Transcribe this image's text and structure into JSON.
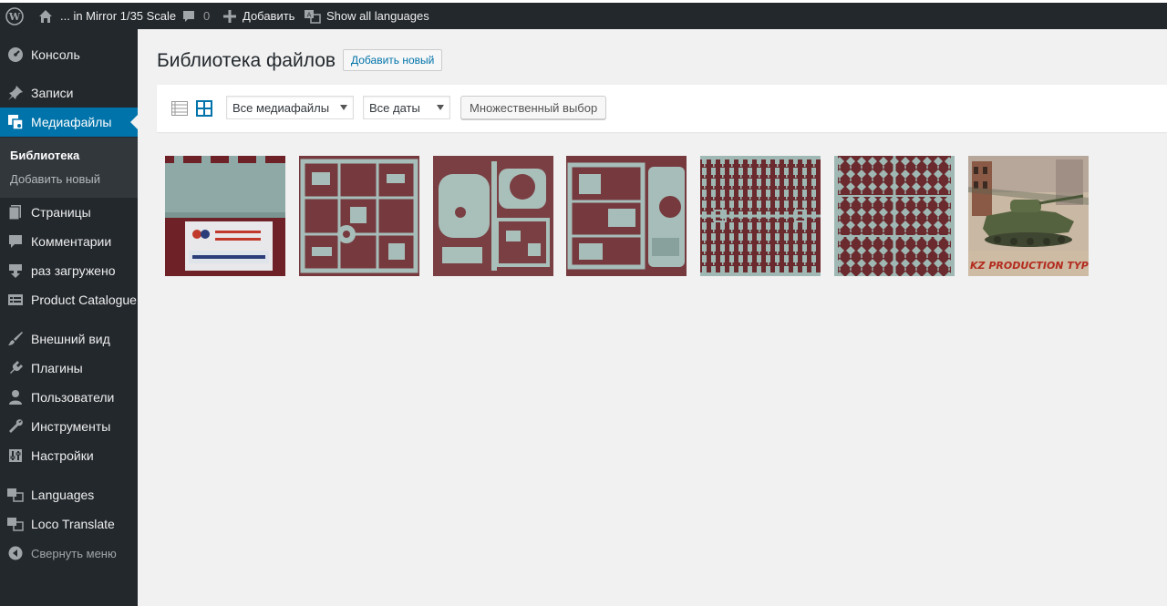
{
  "adminbar": {
    "site_name": "... in Mirror 1/35 Scale",
    "comments_count": "0",
    "new_label": "Добавить",
    "languages_label": "Show all languages"
  },
  "sidebar": {
    "items": [
      {
        "label": "Консоль",
        "icon": "dashboard-icon"
      },
      {
        "label": "Записи",
        "icon": "pin-icon"
      },
      {
        "label": "Медиафайлы",
        "icon": "media-icon"
      },
      {
        "label": "Страницы",
        "icon": "page-icon"
      },
      {
        "label": "Комментарии",
        "icon": "comment-icon"
      },
      {
        "label": "раз загружено",
        "icon": "download-icon"
      },
      {
        "label": "Product Catalogue",
        "icon": "catalogue-icon"
      },
      {
        "label": "Внешний вид",
        "icon": "brush-icon"
      },
      {
        "label": "Плагины",
        "icon": "plugin-icon"
      },
      {
        "label": "Пользователи",
        "icon": "users-icon"
      },
      {
        "label": "Инструменты",
        "icon": "wrench-icon"
      },
      {
        "label": "Настройки",
        "icon": "settings-icon"
      },
      {
        "label": "Languages",
        "icon": "translation-icon"
      },
      {
        "label": "Loco Translate",
        "icon": "translation-icon"
      },
      {
        "label": "Свернуть меню",
        "icon": "collapse-icon"
      }
    ],
    "submenu": {
      "library": "Библиотека",
      "add_new": "Добавить новый"
    }
  },
  "main": {
    "title": "Библиотека файлов",
    "add_new_button": "Добавить новый",
    "filters": {
      "media_type": "Все медиафайлы",
      "dates": "Все даты",
      "bulk_select": "Множественный выбор"
    },
    "thumbnails": [
      {
        "name": "decal-sheet"
      },
      {
        "name": "sprue-1"
      },
      {
        "name": "sprue-turret"
      },
      {
        "name": "sprue-hull"
      },
      {
        "name": "sprue-tracks-1"
      },
      {
        "name": "sprue-tracks-2"
      },
      {
        "name": "box-art"
      }
    ]
  },
  "colors": {
    "accent": "#0073aa",
    "sidebar_bg": "#23282d",
    "plastic": "#9fb8b3",
    "backdrop": "#7a2a2e"
  }
}
